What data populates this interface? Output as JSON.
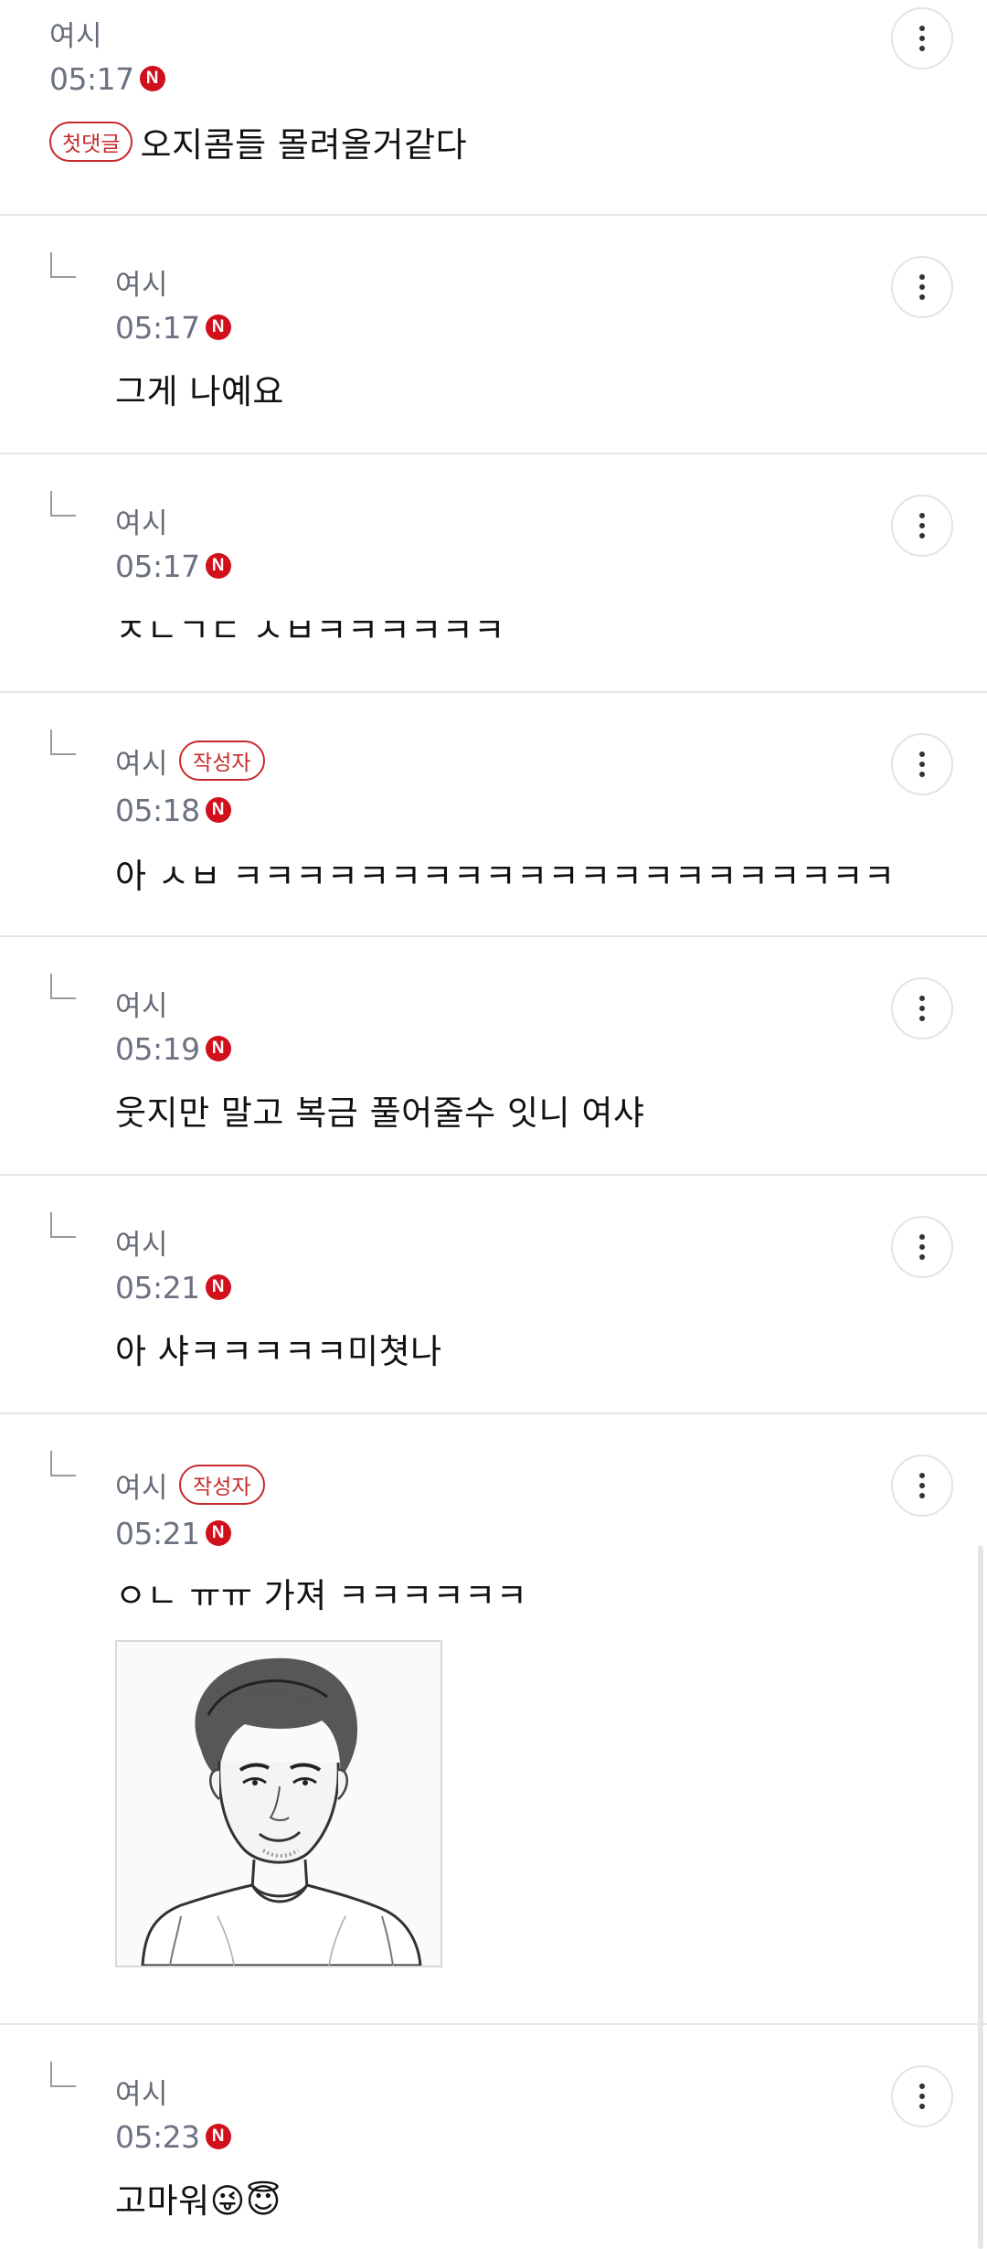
{
  "new_badge": "N",
  "writer_badge": "작성자",
  "first_comment_badge": "첫댓글",
  "icons": {
    "menu": "more-vertical-icon",
    "reply": "reply-corner-icon",
    "new": "new-badge-icon"
  },
  "colors": {
    "accent_red": "#c62a2a",
    "new_badge_red": "#d0101b",
    "meta_gray": "#6b7280"
  },
  "comments": [
    {
      "author": "여시",
      "time": "05:17",
      "text": "오지콤들 몰려올거같다"
    },
    {
      "author": "여시",
      "time": "05:17",
      "text": "그게 나예요"
    },
    {
      "author": "여시",
      "time": "05:17",
      "text": "ㅈㄴㄱㄷ ㅅㅂㅋㅋㅋㅋㅋㅋ"
    },
    {
      "author": "여시",
      "time": "05:18",
      "text": "아 ㅅㅂ ㅋㅋㅋㅋㅋㅋㅋㅋㅋㅋㅋㅋㅋㅋㅋㅋㅋㅋㅋㅋㅋ"
    },
    {
      "author": "여시",
      "time": "05:19",
      "text": "웃지만 말고 복금 풀어줄수 잇니 여샤"
    },
    {
      "author": "여시",
      "time": "05:21",
      "text": "아 샤ㅋㅋㅋㅋㅋ미쳣나"
    },
    {
      "author": "여시",
      "time": "05:21",
      "text": "ㅇㄴ ㅠㅠ 가져 ㅋㅋㅋㅋㅋㅋ"
    },
    {
      "author": "여시",
      "time": "05:23",
      "text": "고마워😜😇"
    }
  ]
}
